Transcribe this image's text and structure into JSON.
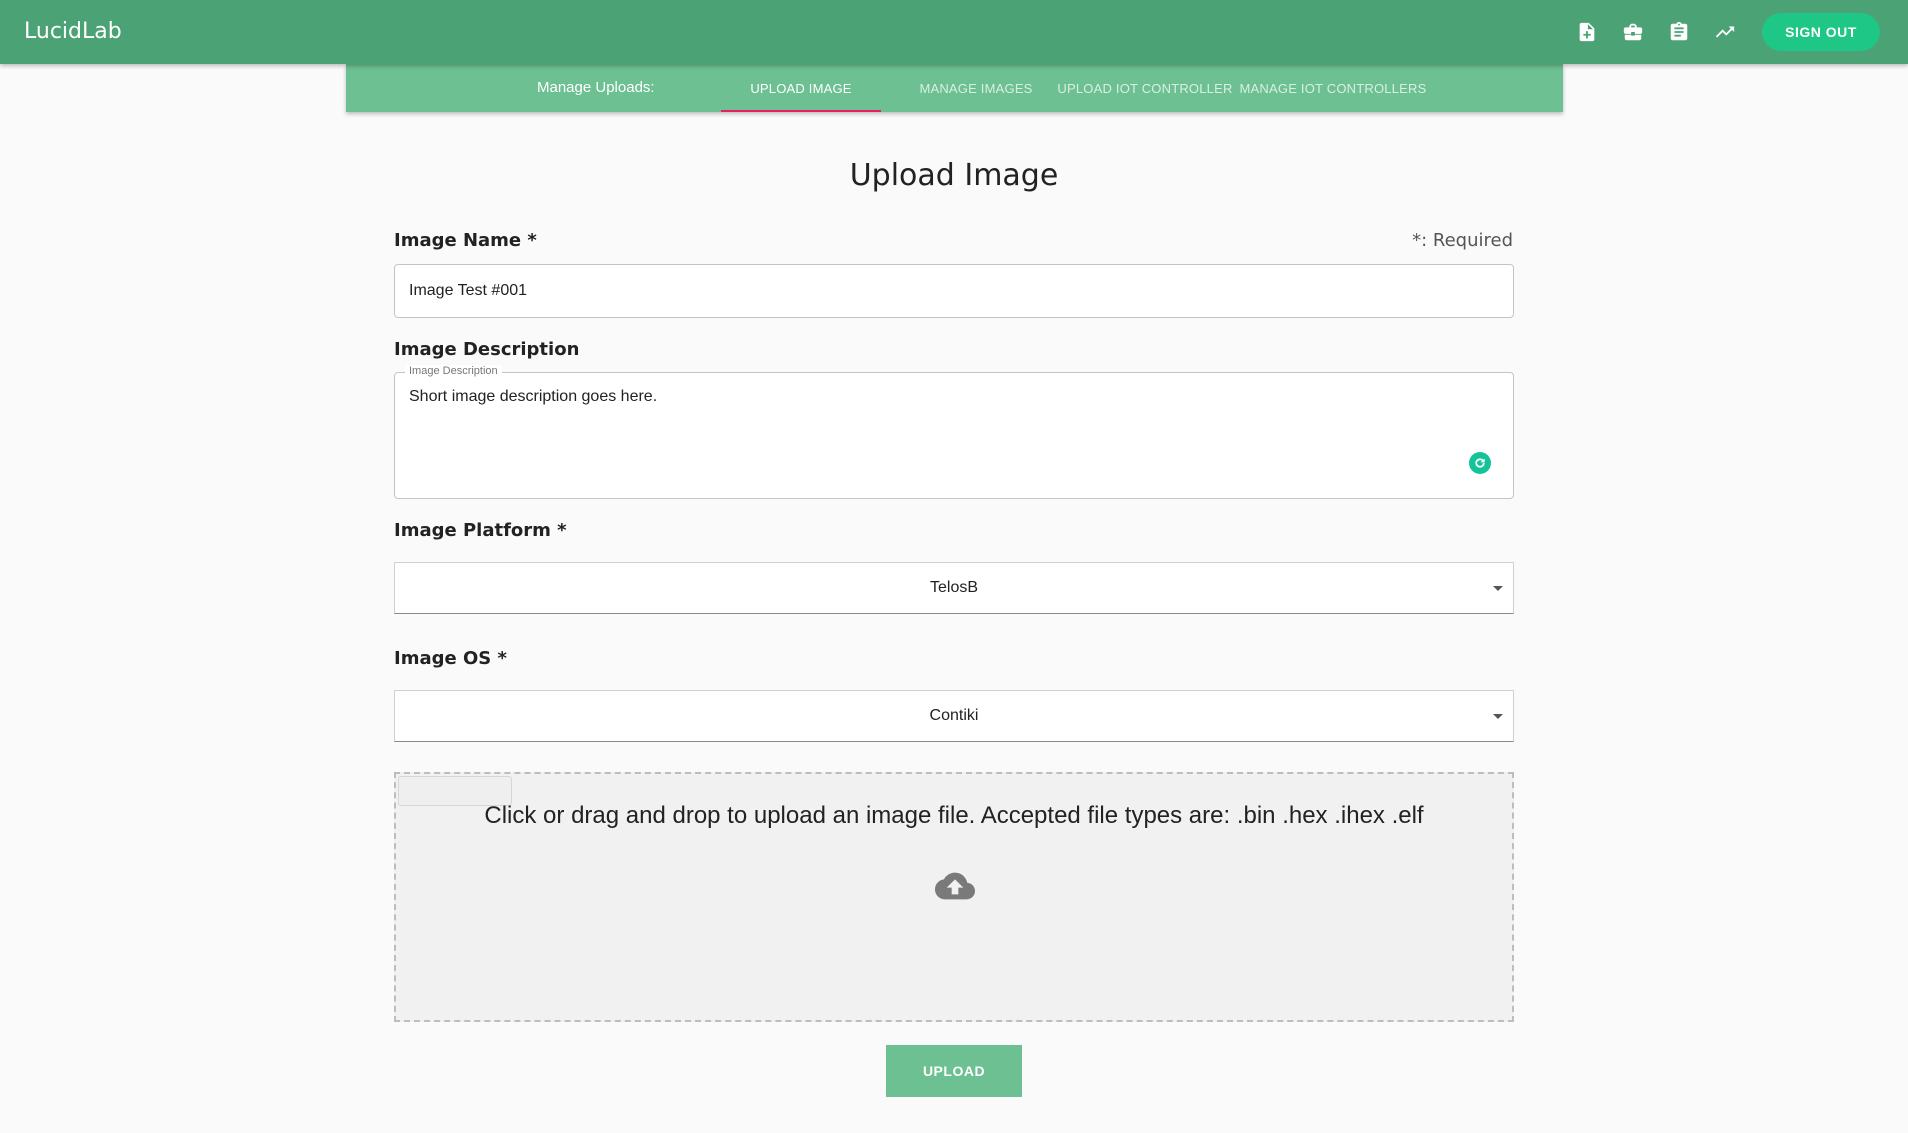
{
  "appbar": {
    "brand": "LucidLab",
    "icons": [
      "file-add-icon",
      "briefcase-icon",
      "clipboard-icon",
      "trending-up-icon"
    ],
    "signout_label": "SIGN OUT"
  },
  "subnav": {
    "label": "Manage Uploads:",
    "tabs": [
      {
        "label": "UPLOAD IMAGE",
        "active": true
      },
      {
        "label": "MANAGE IMAGES",
        "active": false
      },
      {
        "label": "UPLOAD IOT CONTROLLER",
        "active": false
      },
      {
        "label": "MANAGE IOT CONTROLLERS",
        "active": false
      }
    ]
  },
  "form": {
    "title": "Upload Image",
    "required_note": "*: Required",
    "name_label": "Image Name *",
    "name_value": "Image Test #001",
    "description_label": "Image Description",
    "description_legend": "Image Description",
    "description_value": "Short image description goes here.",
    "platform_label": "Image Platform *",
    "platform_value": "TelosB",
    "os_label": "Image OS *",
    "os_value": "Contiki",
    "dropzone_text": "Click or drag and drop to upload an image file. Accepted file types are: .bin .hex .ihex .elf",
    "upload_label": "UPLOAD"
  },
  "colors": {
    "appbar": "#4ba274",
    "subnav": "#6cc091",
    "tab_indicator": "#e91e63",
    "signout": "#1ec785",
    "upload_button": "#6cc091"
  }
}
